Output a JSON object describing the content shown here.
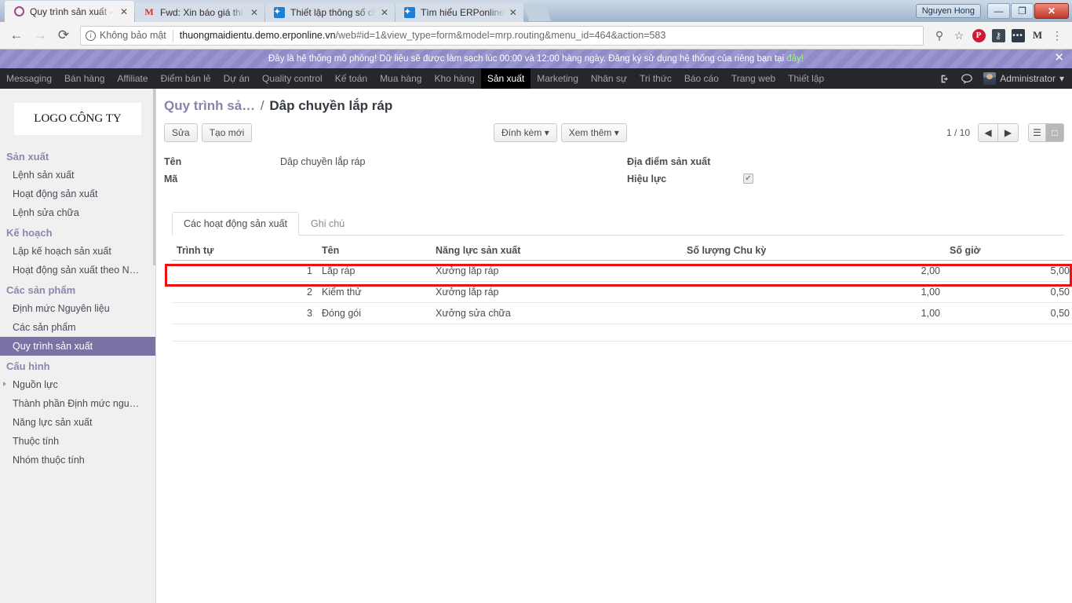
{
  "browser": {
    "tabs": [
      {
        "title": "Quy trình sản xuất - Odo",
        "favicon": "odoo-icon",
        "active": true,
        "close": "✕"
      },
      {
        "title": "Fwd: Xin báo giá thi công",
        "favicon": "gmail-icon",
        "active": false,
        "close": "✕"
      },
      {
        "title": "Thiết lập thông số cho N",
        "favicon": "erponline-icon",
        "active": false,
        "close": "✕"
      },
      {
        "title": "Tìm hiểu ERPonline",
        "favicon": "erponline-icon",
        "active": false,
        "close": "✕"
      }
    ],
    "window": {
      "user_chip": "Nguyen Hong",
      "minimize": "—",
      "restore": "❐",
      "close": "✕"
    },
    "nav": {
      "back": "←",
      "forward": "→",
      "reload": "⟳"
    },
    "omnibox": {
      "security_label": "Không bảo mật",
      "info_glyph": "i",
      "url_host": "thuongmaidientu.demo.erponline.vn",
      "url_path": "/web#id=1&view_type=form&model=mrp.routing&menu_id=464&action=583",
      "zoom_icon": "⚲",
      "bookmark_icon": "☆"
    },
    "extensions": [
      {
        "name": "pinterest-icon",
        "glyph": "P"
      },
      {
        "name": "key-icon",
        "glyph": "⚷"
      },
      {
        "name": "dots-extension-icon",
        "glyph": "•••"
      },
      {
        "name": "gmail-checker-icon",
        "glyph": "M"
      },
      {
        "name": "chrome-menu-icon",
        "glyph": "⋮"
      }
    ]
  },
  "banner": {
    "text_before": "Đây là hệ thống mô phỏng! Dữ liệu sẽ được làm sạch lúc 00:00 và 12:00 hàng ngày. Đăng ký sử dụng hệ thống của riêng bạn tại ",
    "link": "đây!",
    "close": "✕"
  },
  "topnav": {
    "items": [
      {
        "label": "Messaging",
        "active": false
      },
      {
        "label": "Bán hàng",
        "active": false
      },
      {
        "label": "Affiliate",
        "active": false
      },
      {
        "label": "Điểm bán lẻ",
        "active": false
      },
      {
        "label": "Dự án",
        "active": false
      },
      {
        "label": "Quality control",
        "active": false
      },
      {
        "label": "Kế toán",
        "active": false
      },
      {
        "label": "Mua hàng",
        "active": false
      },
      {
        "label": "Kho hàng",
        "active": false
      },
      {
        "label": "Sản xuất",
        "active": true
      },
      {
        "label": "Marketing",
        "active": false
      },
      {
        "label": "Nhân sự",
        "active": false
      },
      {
        "label": "Tri thức",
        "active": false
      },
      {
        "label": "Báo cáo",
        "active": false
      },
      {
        "label": "Trang web",
        "active": false
      },
      {
        "label": "Thiết lập",
        "active": false
      }
    ],
    "logout_icon": "⏻",
    "chat_icon": "●",
    "username": "Administrator",
    "caret": "▾"
  },
  "sidebar": {
    "logo": "LOGO CÔNG TY",
    "groups": [
      {
        "title": "Sản xuất",
        "items": [
          {
            "label": "Lệnh sản xuất",
            "selected": false,
            "caret": false
          },
          {
            "label": "Hoạt động sản xuất",
            "selected": false,
            "caret": false
          },
          {
            "label": "Lệnh sửa chữa",
            "selected": false,
            "caret": false
          }
        ]
      },
      {
        "title": "Kế hoạch",
        "items": [
          {
            "label": "Lập kế hoạch sản xuất",
            "selected": false,
            "caret": false
          },
          {
            "label": "Hoạt động sản xuất theo N…",
            "selected": false,
            "caret": false
          }
        ]
      },
      {
        "title": "Các sản phẩm",
        "items": [
          {
            "label": "Định mức Nguyên liệu",
            "selected": false,
            "caret": false
          },
          {
            "label": "Các sản phẩm",
            "selected": false,
            "caret": false
          },
          {
            "label": "Quy trình sản xuất",
            "selected": true,
            "caret": false
          }
        ]
      },
      {
        "title": "Cấu hình",
        "items": [
          {
            "label": "Nguồn lực",
            "selected": false,
            "caret": true
          },
          {
            "label": "Thành phần Định mức ngu…",
            "selected": false,
            "caret": false
          },
          {
            "label": "Năng lực sản xuất",
            "selected": false,
            "caret": false
          },
          {
            "label": "Thuộc tính",
            "selected": false,
            "caret": false
          },
          {
            "label": "Nhóm thuộc tính",
            "selected": false,
            "caret": false
          }
        ]
      }
    ]
  },
  "breadcrumb": {
    "parent": "Quy trình sả…",
    "separator": "/",
    "current": "Dâp chuyền lắp ráp"
  },
  "toolbar": {
    "edit_label": "Sửa",
    "create_label": "Tạo mới",
    "attachment_label": "Đính kèm",
    "more_label": "Xem thêm",
    "caret": "▾",
    "pager": "1 / 10",
    "prev_icon": "◀",
    "next_icon": "▶",
    "list_view_icon": "☰",
    "form_view_icon": "□"
  },
  "form": {
    "left": [
      {
        "label": "Tên",
        "value": "Dâp chuyền lắp ráp",
        "type": "text"
      },
      {
        "label": "Mã",
        "value": "",
        "type": "text"
      }
    ],
    "right": [
      {
        "label": "Địa điểm sản xuất",
        "value": "",
        "type": "text"
      },
      {
        "label": "Hiệu lực",
        "value": "✔",
        "type": "checkbox",
        "checked": true
      }
    ]
  },
  "notebook": {
    "tabs": [
      {
        "label": "Các hoạt động sản xuất",
        "active": true
      },
      {
        "label": "Ghi chú",
        "active": false
      }
    ]
  },
  "table": {
    "columns": [
      "Trình tự",
      "Tên",
      "Năng lực sản xuất",
      "Số lượng Chu kỳ",
      "Số giờ"
    ],
    "rows": [
      {
        "seq": "1",
        "name": "Lắp ráp",
        "workcenter": "Xưởng lắp ráp",
        "cycle": "2,00",
        "hours": "5,00",
        "highlighted": true
      },
      {
        "seq": "2",
        "name": "Kiểm thử",
        "workcenter": "Xưởng lắp ráp",
        "cycle": "1,00",
        "hours": "0,50",
        "highlighted": false
      },
      {
        "seq": "3",
        "name": "Đóng gói",
        "workcenter": "Xưởng sửa chữa",
        "cycle": "1,00",
        "hours": "0,50",
        "highlighted": false
      }
    ]
  },
  "colors": {
    "highlight": "#ee1111",
    "sidebar_selected": "#7c71a5",
    "section_heading": "#8e86ad",
    "banner": "#8f8bc6",
    "topnav": "#25272b"
  }
}
